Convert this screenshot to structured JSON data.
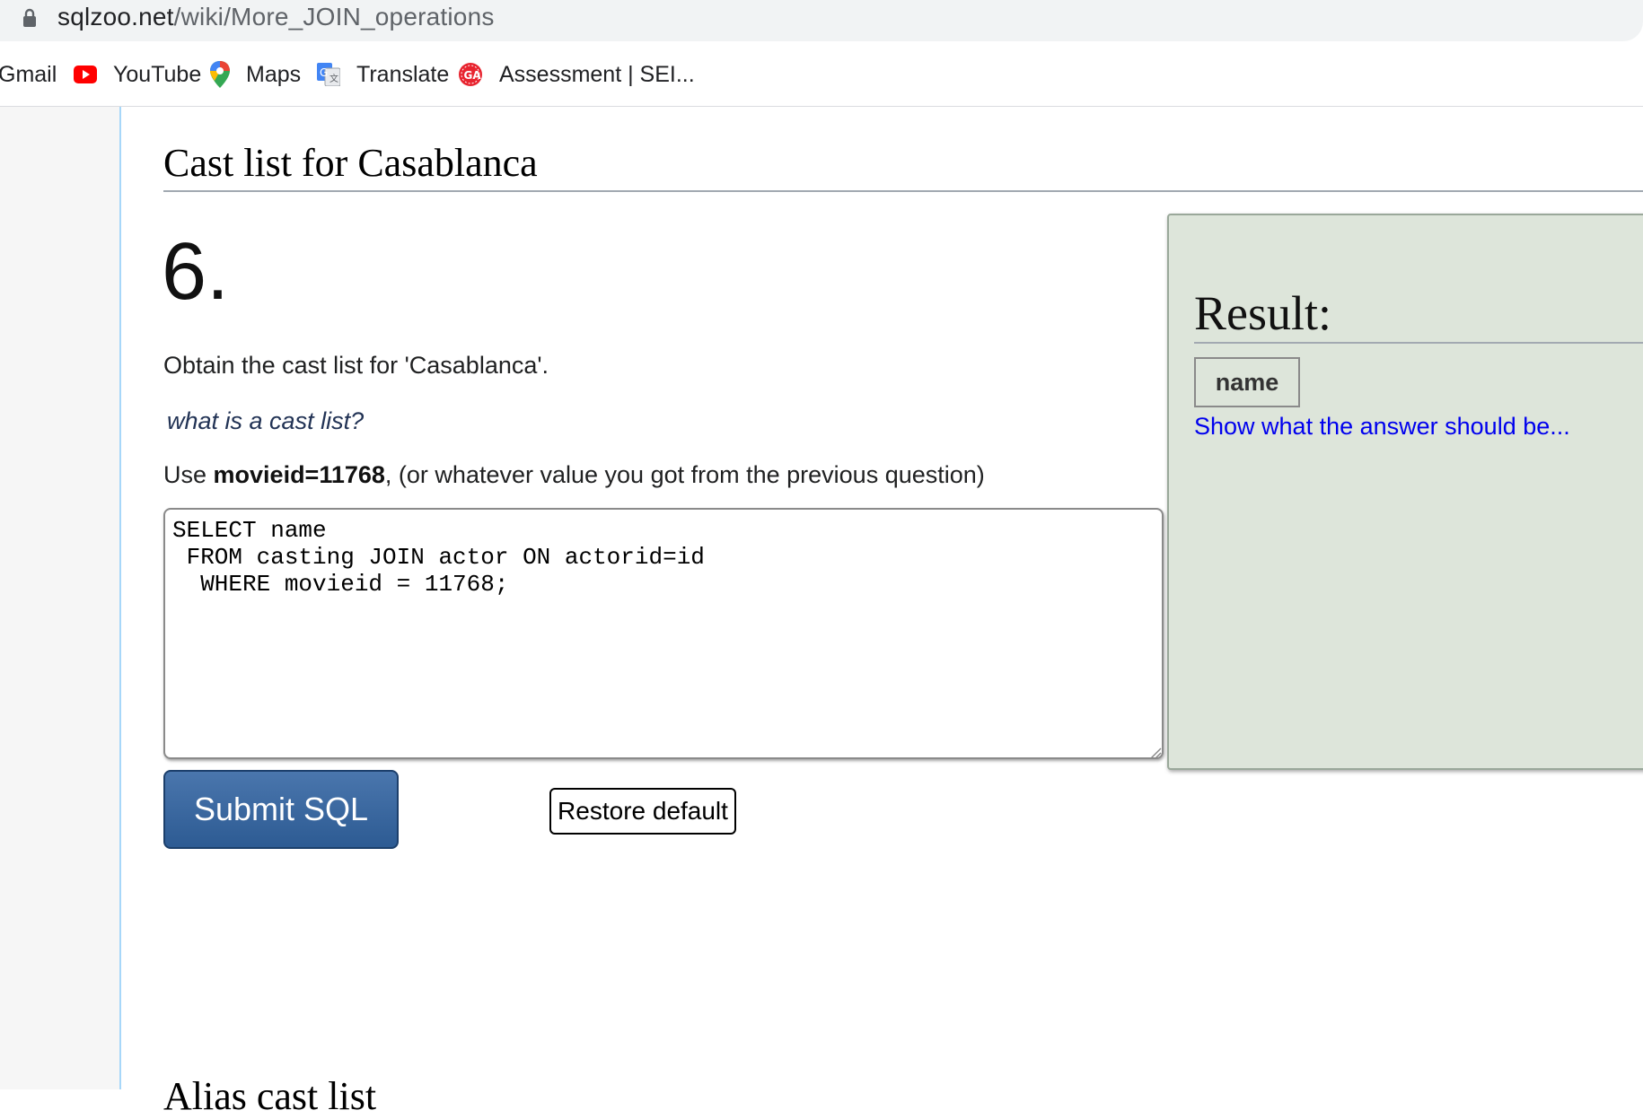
{
  "browser": {
    "url_domain": "sqlzoo.net",
    "url_path": "/wiki/More_JOIN_operations",
    "bookmarks": [
      {
        "label": "Gmail",
        "icon": "gmail-icon"
      },
      {
        "label": "YouTube",
        "icon": "youtube-icon"
      },
      {
        "label": "Maps",
        "icon": "maps-icon"
      },
      {
        "label": "Translate",
        "icon": "translate-icon"
      },
      {
        "label": "Assessment | SEI...",
        "icon": "ga-icon"
      }
    ]
  },
  "page": {
    "section_heading": "Cast list for Casablanca",
    "question_number": "6.",
    "instruction": "Obtain the cast list for 'Casablanca'.",
    "hint_link": "what is a cast list?",
    "use_prefix": "Use ",
    "use_bold": "movieid=11768",
    "use_suffix": ", (or whatever value you got from the previous question)",
    "sql_text": "SELECT name\n FROM casting JOIN actor ON actorid=id\n  WHERE movieid = 11768;",
    "submit_label": "Submit SQL",
    "restore_label": "Restore default",
    "next_heading": "Alias cast list"
  },
  "result": {
    "title": "Result:",
    "column_header": "name",
    "answer_link": "Show what the answer should be..."
  },
  "colors": {
    "link": "#0000ee",
    "result_bg": "#dde5da",
    "submit_bg": "#2d5b93"
  }
}
